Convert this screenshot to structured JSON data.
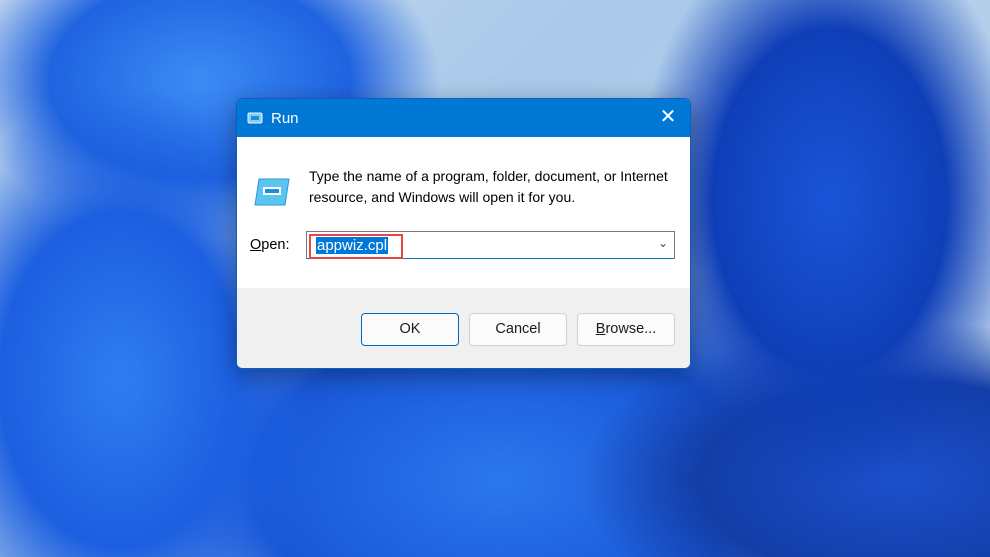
{
  "dialog": {
    "title": "Run",
    "message": "Type the name of a program, folder, document, or Internet resource, and Windows will open it for you.",
    "open_label_first": "O",
    "open_label_rest": "pen:",
    "open_value": "appwiz.cpl",
    "buttons": {
      "ok": "OK",
      "cancel": "Cancel",
      "browse_first": "B",
      "browse_rest": "rowse..."
    }
  },
  "colors": {
    "accent": "#0078d4",
    "highlight": "#e84545"
  }
}
